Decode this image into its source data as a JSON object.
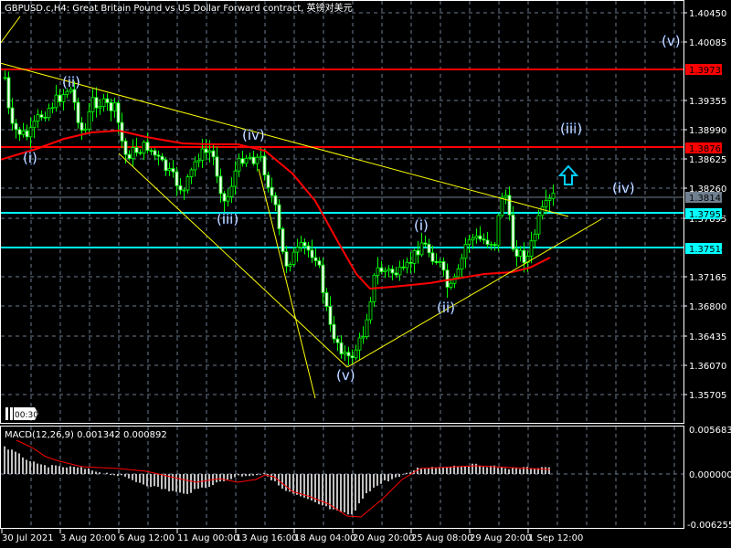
{
  "chart": {
    "symbol_title": "GBPUSD.c,H4:  Great Britain Pound vs US Dollar Forward contract, 英镑对美元",
    "timer": "00:30",
    "price_ticks": [
      "1.40450",
      "1.40085",
      "1.39355",
      "1.38990",
      "1.38625",
      "1.38260",
      "1.37895",
      "1.37165",
      "1.36800",
      "1.36435",
      "1.36070",
      "1.35705"
    ],
    "level_labels": {
      "red_upper": "1.39736",
      "red_lower": "1.38763",
      "current_price": "1.38149",
      "cyan_upper": "1.37952",
      "cyan_lower": "1.37514"
    },
    "colors": {
      "red_level": "#ff0000",
      "cyan_level": "#00ffff",
      "current_price": "#708090",
      "trendline": "#ffff00",
      "moving_average": "#ff0000",
      "candle": "#00ff00"
    },
    "wave_labels": [
      "(ii)",
      "(i)",
      "(iv)",
      "(iii)",
      "(v)",
      "(i)",
      "(ii)",
      "(iii)",
      "(iv)",
      "(v)"
    ],
    "arrow_icon": "up-arrow-icon",
    "time_labels": [
      "30 Jul 2021",
      "3 Aug 20:00",
      "6 Aug 12:00",
      "11 Aug 00:00",
      "13 Aug 16:00",
      "18 Aug 04:00",
      "20 Aug 20:00",
      "25 Aug 08:00",
      "29 Aug 20:00",
      "1 Sep 12:00"
    ]
  },
  "macd": {
    "label": "MACD(12,26,9) 0.001342 0.000892",
    "ticks": [
      "0.005683",
      "0.000000",
      "-0.006255"
    ]
  }
}
